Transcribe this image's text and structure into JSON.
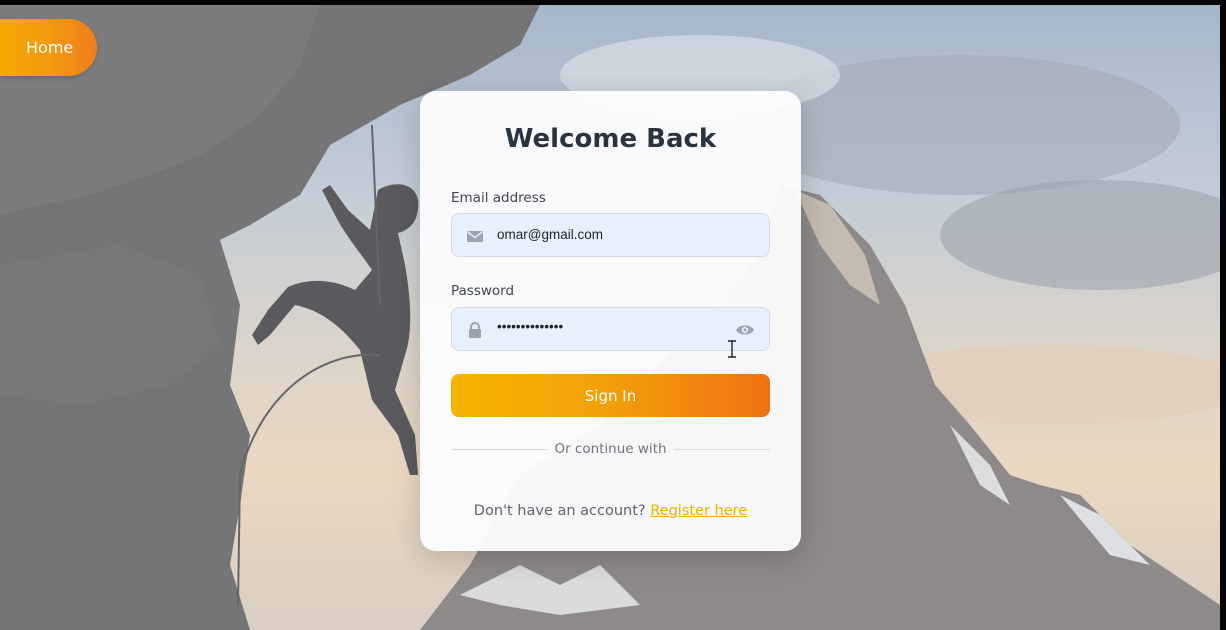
{
  "home": {
    "label": "Home"
  },
  "form": {
    "title": "Welcome Back",
    "email": {
      "label": "Email address",
      "value": "omar@gmail.com",
      "icon": "envelope-icon"
    },
    "password": {
      "label": "Password",
      "value": "••••••••••••••",
      "icon": "lock-icon",
      "toggle_icon": "eye-icon"
    },
    "submit_label": "Sign In",
    "divider_text": "Or continue with",
    "register_prompt": "Don't have an account?",
    "register_link": "Register here"
  },
  "colors": {
    "accent_start": "#f4b400",
    "accent_end": "#ef7212",
    "link": "#f0b000",
    "title": "#2a3340",
    "input_bg": "#e8f0fd"
  }
}
